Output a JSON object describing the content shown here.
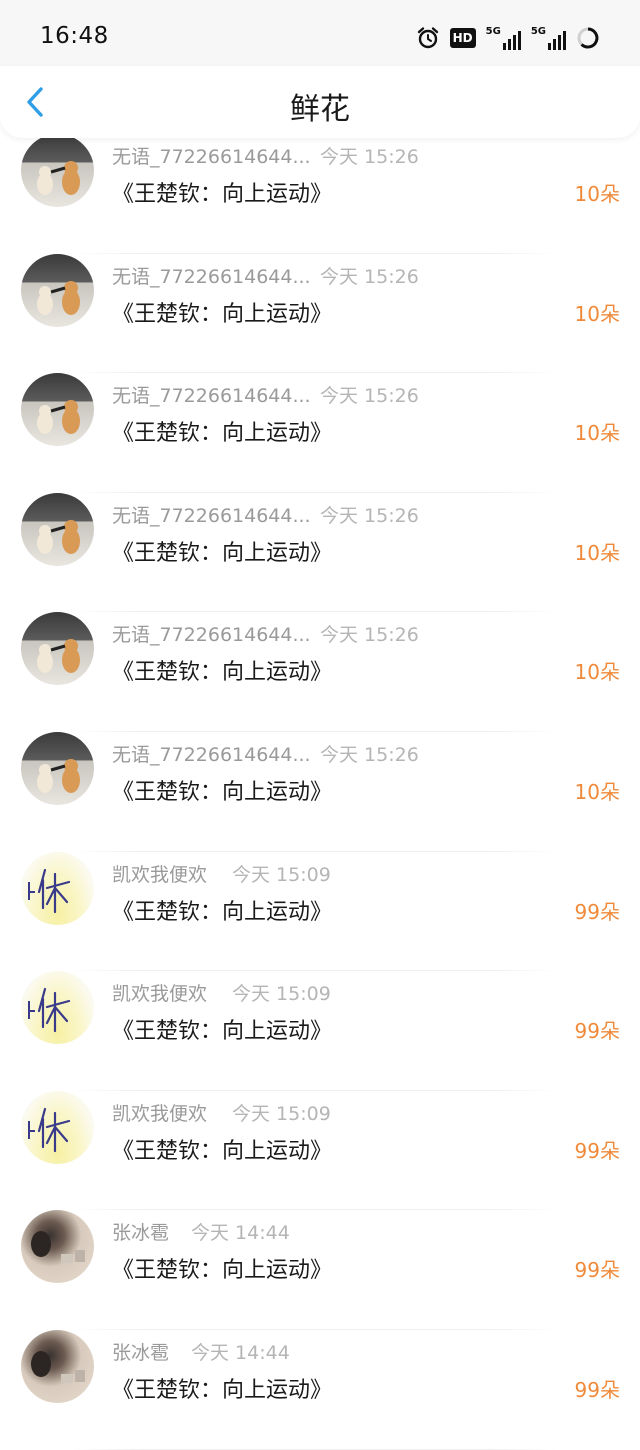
{
  "status_bar": {
    "time": "16:48",
    "icons": [
      "alarm-icon",
      "hd-icon",
      "5g-signal-icon",
      "5g-signal-icon",
      "battery-ring-icon"
    ],
    "hd_label": "HD",
    "network_label_1": "5G",
    "network_label_2": "5G"
  },
  "header": {
    "title": "鲜花",
    "back_icon": "chevron-left-icon",
    "accent_color": "#2e9fe6"
  },
  "list": {
    "count_color": "#f08a3a",
    "items": [
      {
        "avatar": "cats",
        "name": "无语_77226614644...",
        "time": "今天 15:26",
        "title": "《王楚钦：向上运动》",
        "count": "10朵"
      },
      {
        "avatar": "cats",
        "name": "无语_77226614644...",
        "time": "今天 15:26",
        "title": "《王楚钦：向上运动》",
        "count": "10朵"
      },
      {
        "avatar": "cats",
        "name": "无语_77226614644...",
        "time": "今天 15:26",
        "title": "《王楚钦：向上运动》",
        "count": "10朵"
      },
      {
        "avatar": "cats",
        "name": "无语_77226614644...",
        "time": "今天 15:26",
        "title": "《王楚钦：向上运动》",
        "count": "10朵"
      },
      {
        "avatar": "cats",
        "name": "无语_77226614644...",
        "time": "今天 15:26",
        "title": "《王楚钦：向上运动》",
        "count": "10朵"
      },
      {
        "avatar": "cats",
        "name": "无语_77226614644...",
        "time": "今天 15:26",
        "title": "《王楚钦：向上运动》",
        "count": "10朵"
      },
      {
        "avatar": "handwriting",
        "name": "凯欢我便欢",
        "time": "今天 15:09",
        "title": "《王楚钦：向上运动》",
        "count": "99朵"
      },
      {
        "avatar": "handwriting",
        "name": "凯欢我便欢",
        "time": "今天 15:09",
        "title": "《王楚钦：向上运动》",
        "count": "99朵"
      },
      {
        "avatar": "handwriting",
        "name": "凯欢我便欢",
        "time": "今天 15:09",
        "title": "《王楚钦：向上运动》",
        "count": "99朵"
      },
      {
        "avatar": "photo",
        "name": "张冰雹",
        "time": "今天 14:44",
        "title": "《王楚钦：向上运动》",
        "count": "99朵"
      },
      {
        "avatar": "photo",
        "name": "张冰雹",
        "time": "今天 14:44",
        "title": "《王楚钦：向上运动》",
        "count": "99朵"
      }
    ]
  }
}
